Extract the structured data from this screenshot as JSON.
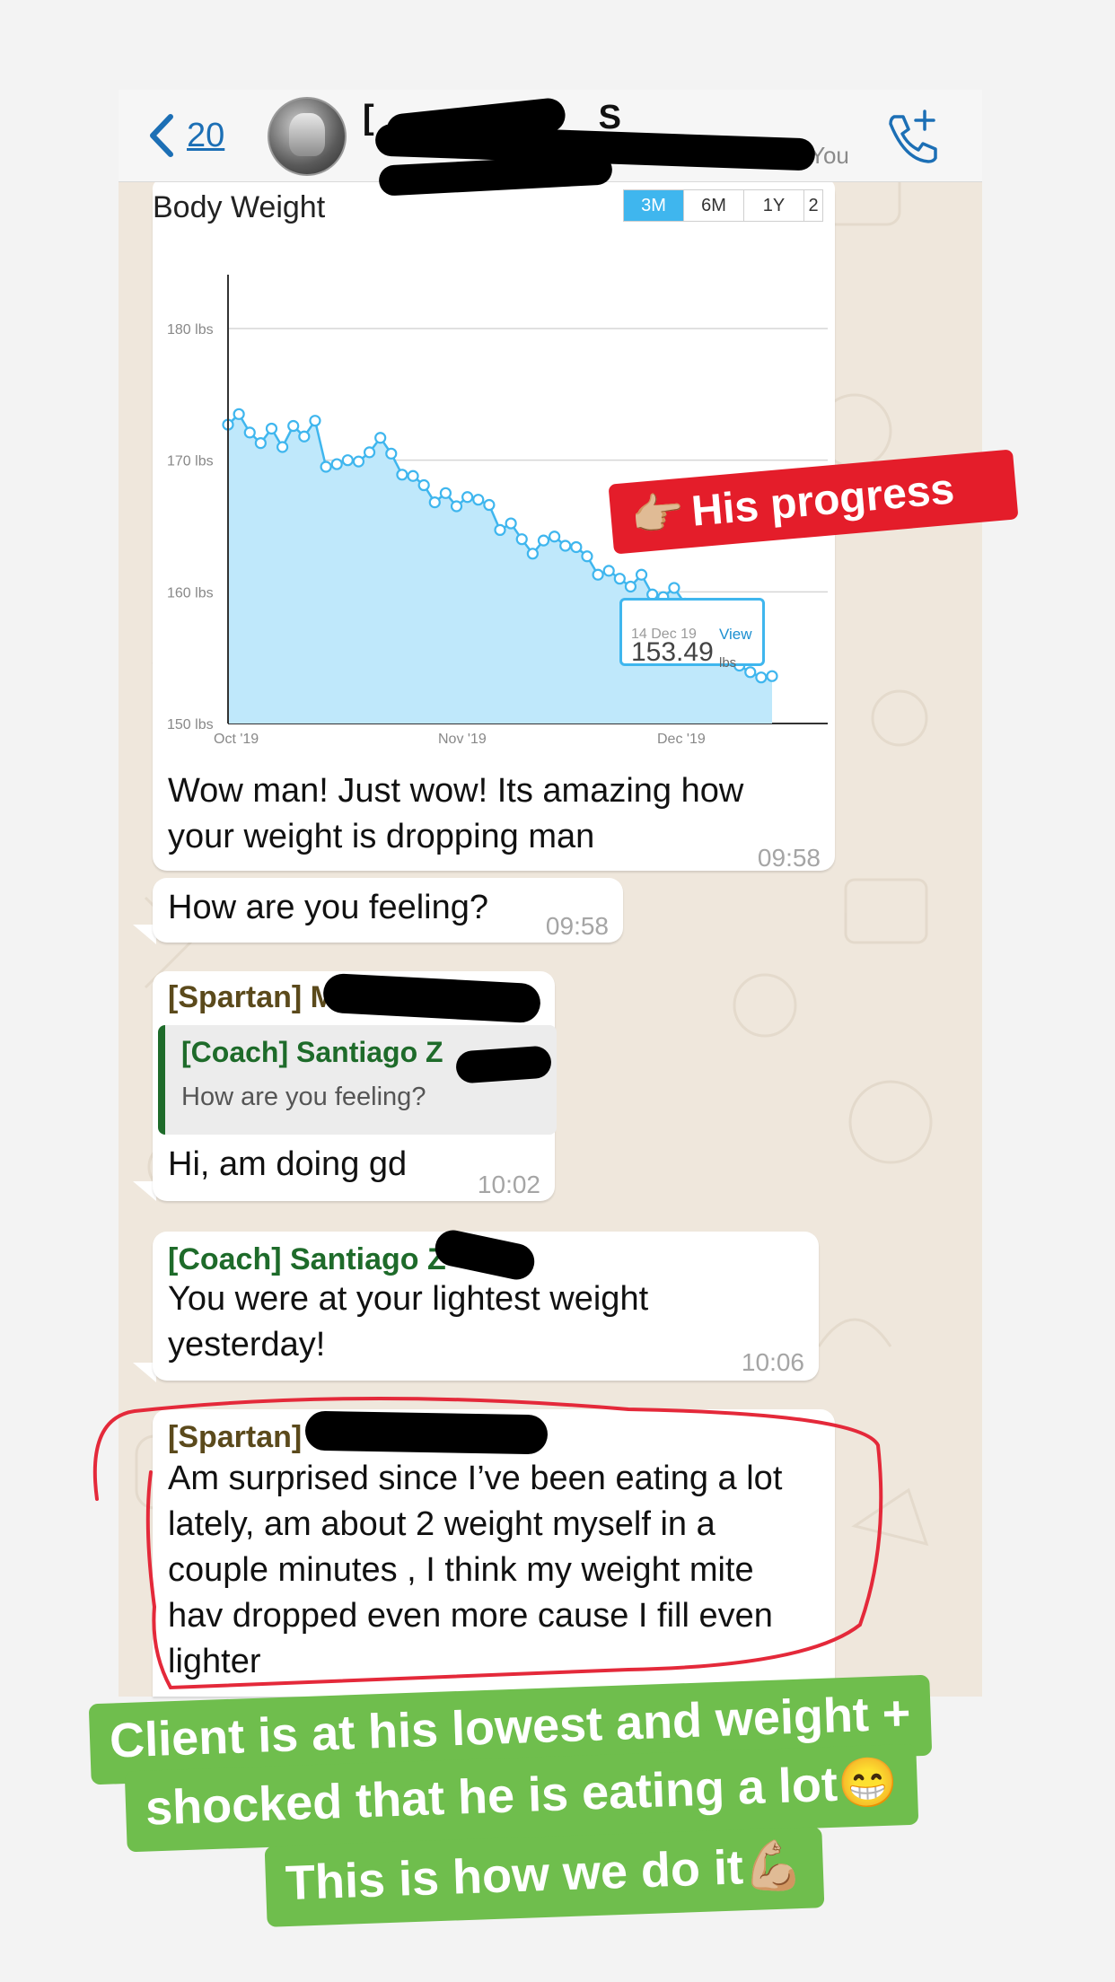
{
  "header": {
    "back_count": "20",
    "name_visible": "[",
    "name_suffix": "S",
    "subtitle_suffix": "You",
    "icons": [
      "chevron-left-icon",
      "add-call-icon"
    ]
  },
  "chart_bubble": {
    "chart_data": {
      "type": "area",
      "title": "Body Weight",
      "range_tabs": [
        "3M",
        "6M",
        "1Y",
        "2"
      ],
      "active_tab": "3M",
      "y_tick_labels": [
        "180 lbs",
        "170 lbs",
        "160 lbs",
        "150 lbs"
      ],
      "ylim": [
        150,
        180
      ],
      "x_tick_labels": [
        "Oct '19",
        "Nov '19",
        "Dec '19"
      ],
      "series": [
        {
          "values": [
            172.7,
            173.5,
            172.1,
            171.3,
            172.4,
            171.0,
            172.6,
            171.8,
            173.0,
            169.5,
            169.7,
            170.0,
            169.9,
            170.6,
            171.7,
            170.5,
            168.9,
            168.8,
            168.1,
            166.8,
            167.5,
            166.5,
            167.2,
            167.0,
            166.6,
            164.7,
            165.2,
            164.0,
            162.9,
            163.9,
            164.2,
            163.5,
            163.4,
            162.7,
            161.3,
            161.6,
            161.0,
            160.4,
            161.3,
            159.8,
            159.6,
            160.3,
            159.1,
            158.9,
            157.9,
            155.8,
            155.3,
            154.4,
            153.9,
            153.5,
            153.6
          ]
        }
      ],
      "tooltip": {
        "date": "14 Dec 19",
        "link": "View",
        "value": "153.49",
        "unit": "lbs"
      },
      "color": "#3fb6ee",
      "fill": "#bfe8fb",
      "grid": true
    },
    "caption": "Wow man! Just wow! Its amazing how your weight is dropping man",
    "caption_line1": "Wow man! Just wow! Its amazing how",
    "caption_line2": "your weight is dropping man",
    "time": "09:58"
  },
  "messages": [
    {
      "text": "How are you feeling?",
      "time": "09:58"
    },
    {
      "sender": "[Spartan] M",
      "quote_author": "[Coach] Santiago Z",
      "quote_text": "How are you feeling?",
      "text": "Hi, am doing gd",
      "time": "10:02"
    },
    {
      "sender": "[Coach] Santiago Z",
      "line1": "You were at your lightest weight",
      "line2": "yesterday!",
      "time": "10:06"
    },
    {
      "sender": "[Spartan]",
      "line1": "Am surprised since I’ve been eating a lot",
      "line2": "lately, am about 2 weight myself in a",
      "line3": "couple minutes  , I think my weight mite",
      "line4": "hav dropped even more cause I fill even",
      "line5": "lighter"
    }
  ],
  "stickers": {
    "progress": {
      "emoji": "👉🏼",
      "label": "His progress"
    },
    "caption_line1": "Client is at his lowest and weight +",
    "caption_line2": "shocked that he is eating a lot😁",
    "caption_line3": "This is how we do it💪🏼"
  },
  "colors": {
    "accent_blue": "#1c6fb5",
    "chat_background": "#efe7dc",
    "sticker_red": "#e41d2a",
    "sticker_green": "#6fbe4d",
    "spartan_name": "#5b4a1c",
    "coach_name": "#1e6b2a",
    "circle_red": "#e4293a"
  }
}
